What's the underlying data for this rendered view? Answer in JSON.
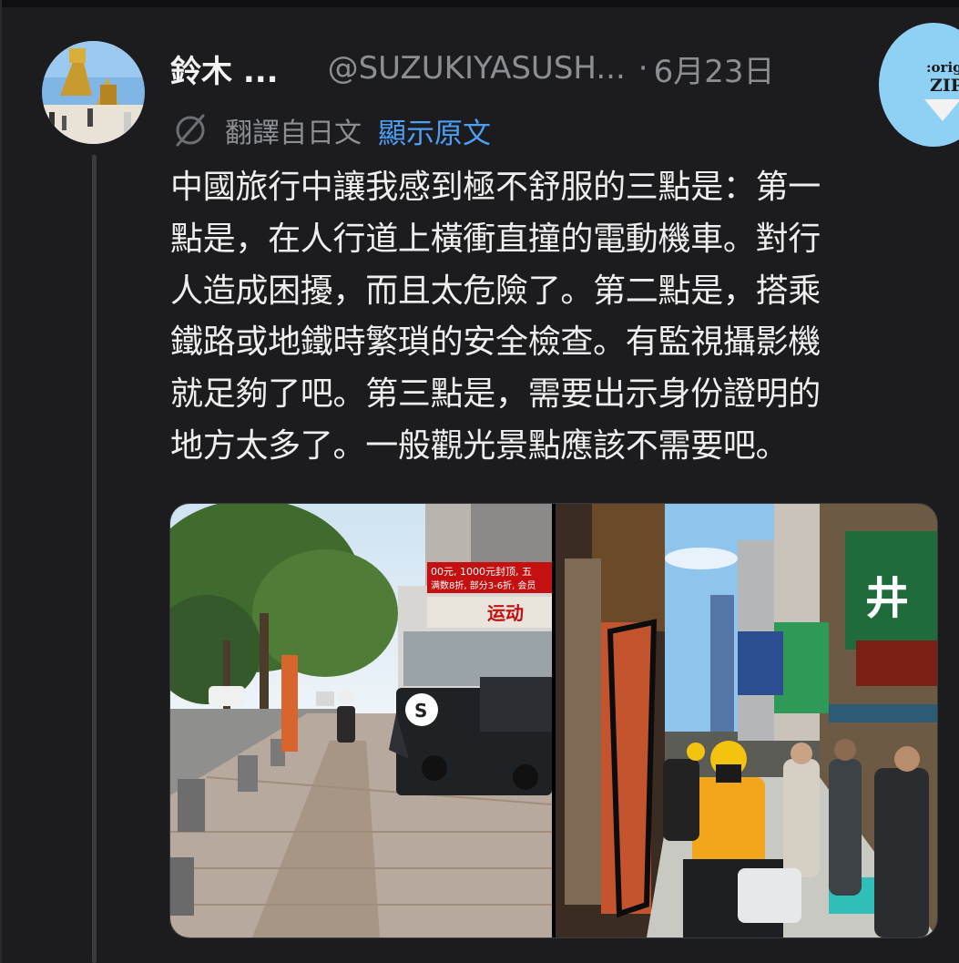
{
  "post": {
    "display_name": "鈴木 ...",
    "handle": "@SUZUKIYASUSH...",
    "separator": "·",
    "date": "6月23日",
    "translation_label": "翻譯自日文",
    "show_original_label": "顯示原文",
    "body_lines": [
      "中國旅行中讓我感到極不舒服的三點是：第一",
      "點是，在人行道上橫衝直撞的電動機車。對行",
      "人造成困擾，而且太危險了。第二點是，搭乘",
      "鐵路或地鐵時繁瑣的安全檢查。有監視攝影機",
      "就足夠了吧。第三點是，需要出示身份證明的",
      "地方太多了。一般觀光景點應該不需要吧。"
    ]
  },
  "badge": {
    "line1": ":orig",
    "line2": "ZIP"
  },
  "media": {
    "left_photo": {
      "sign_red": "00元, 1000元封顶, 五",
      "sign_red_2": "满数8折, 部分3-6折, 会员",
      "store_sign": "运动",
      "van_logo": "S"
    },
    "right_photo": {
      "shop_sign": "井"
    }
  },
  "colors": {
    "background": "#1c1c1e",
    "text": "#e7e9ea",
    "muted": "#8b8f94",
    "link": "#4d9ff5",
    "badge": "#8fd0f5"
  },
  "icons": [
    "translate-icon",
    "avatar",
    "badge-arrow-icon"
  ]
}
